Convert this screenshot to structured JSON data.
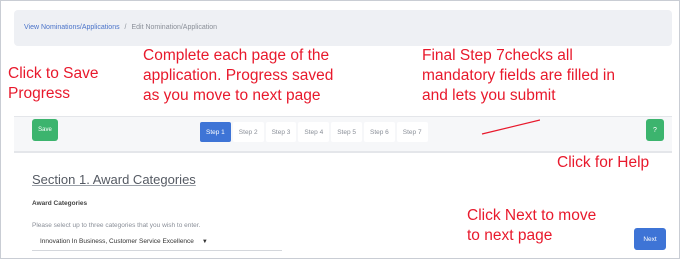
{
  "breadcrumb": {
    "link": "View Nominations/Applications",
    "separator": "/",
    "current": "Edit Nomination/Application"
  },
  "toolbar": {
    "save_label": "Save",
    "help_label": "?",
    "steps": [
      "Step 1",
      "Step 2",
      "Step 3",
      "Step 4",
      "Step 5",
      "Step 6",
      "Step 7"
    ],
    "active_step": "Step 1"
  },
  "section": {
    "title": "Section 1. Award Categories",
    "field_label": "Award Categories",
    "field_help": "Please select up to three categories that you wish to enter.",
    "selected_value": "Innovation In Business, Customer Service Excellence",
    "next_label": "Next"
  },
  "annotations": {
    "save": [
      "Click to Save",
      "Progress"
    ],
    "progress": [
      "Complete each page of the",
      "application. Progress saved",
      "as you move to next page"
    ],
    "final": [
      "Final Step 7checks all",
      "mandatory fields are filled in",
      "and lets you submit"
    ],
    "help": [
      "Click for Help"
    ],
    "next": [
      "Click Next to move",
      "to next page"
    ],
    "color": "#e8192c"
  },
  "colors": {
    "primary": "#3e74d6",
    "success": "#3cb46e",
    "annotation": "#e8192c"
  }
}
